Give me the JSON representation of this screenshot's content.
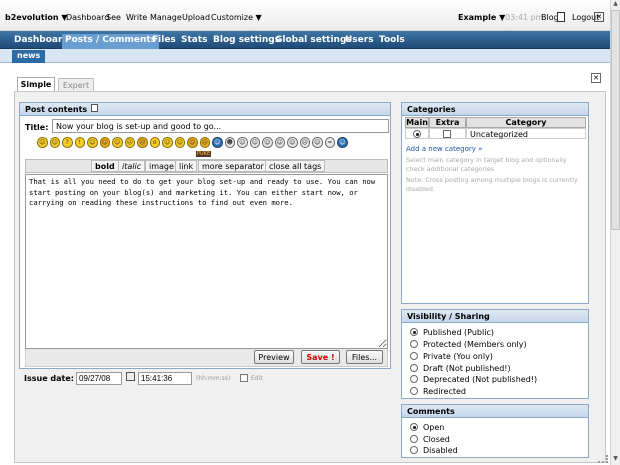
{
  "topbar": {
    "brand": "b2evolution",
    "links": [
      "Dashboard",
      "See",
      "Write",
      "Manage",
      "Upload",
      "Customize"
    ],
    "blog_select": "Example",
    "time": "03:41 pm",
    "blog_link": "Blog",
    "logout": "Logout"
  },
  "mainnav": [
    "Dashboard",
    "Posts / Comments",
    "Files",
    "Stats",
    "Blog settings",
    "Global settings",
    "Users",
    "Tools"
  ],
  "subnav": {
    "active_tab": "news"
  },
  "edit_tabs": {
    "simple": "Simple",
    "expert": "Expert"
  },
  "post": {
    "panel_title": "Post contents",
    "title_label": "Title:",
    "title_value": "Now your blog is set-up and good to go...",
    "toolbar": [
      "bold",
      "italic",
      "image",
      "link",
      "more separator",
      "close all tags"
    ],
    "smiley_label": "PUKE",
    "content": "That is all you need to do to get your blog set-up and ready to use. You can now start posting on your blog(s) and marketing it. You can either start now, or carrying on reading these instructions to find out even more.",
    "buttons": {
      "preview": "Preview",
      "save": "Save !",
      "files": "Files..."
    },
    "issue_date_label": "Issue date:",
    "issue_date": "09/27/08",
    "issue_time": "15:41:36",
    "time_hint": "(hh:mm:ss)",
    "edit_label": "Edit"
  },
  "categories": {
    "title": "Categories",
    "columns": [
      "Main",
      "Extra",
      "Category"
    ],
    "rows": [
      {
        "name": "Uncategorized",
        "main": true,
        "extra": false
      }
    ],
    "add_new": "Add a new category »",
    "note1": "Select main category in target blog and optionally check additional categories",
    "note2": "Note: Cross posting among multiple blogs is currently disabled."
  },
  "visibility": {
    "title": "Visibility / Sharing",
    "options": [
      "Published (Public)",
      "Protected (Members only)",
      "Private (You only)",
      "Draft (Not published!)",
      "Deprecated (Not published!)",
      "Redirected"
    ],
    "selected": 0
  },
  "comments": {
    "title": "Comments",
    "options": [
      "Open",
      "Closed",
      "Disabled"
    ],
    "selected": 0
  },
  "colors": {
    "nav_blue": "#2b5f91",
    "active_tab": "#6a9dd0",
    "panel_header": "#c4d6ea",
    "save_red": "#cc0000"
  }
}
